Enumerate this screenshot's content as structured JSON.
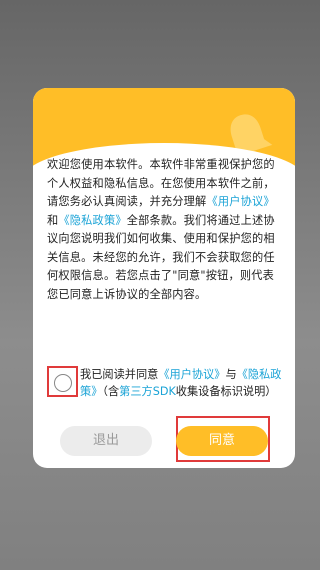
{
  "dialog": {
    "paragraphs": [
      {
        "segments": [
          {
            "text": "欢迎您使用本软件。本软件非常重视保护您的个人权益和隐私信息。在您使用本软件之前，请您务必认真阅读，并充分理解",
            "link": false
          },
          {
            "text": "《用户协议》",
            "link": true
          },
          {
            "text": "和",
            "link": false
          },
          {
            "text": "《隐私政策》",
            "link": true
          },
          {
            "text": "全部条款。我们将通过上述协议向您说明我们如何收集、使用和保护您的相关信息。未经您的允许，我们不会获取您的任何权限信息。若您点击了\"同意\"按钮，则代表您已同意上诉协议的全部内容。",
            "link": false
          }
        ]
      }
    ],
    "agree": {
      "segments": [
        {
          "text": "我已阅读并同意",
          "link": false
        },
        {
          "text": "《用户协议》",
          "link": true
        },
        {
          "text": "与",
          "link": false
        },
        {
          "text": "《隐私政策》",
          "link": true
        },
        {
          "text": "（含",
          "link": false
        },
        {
          "text": "第三方SDK",
          "link": true
        },
        {
          "text": "收集设备标识说明）",
          "link": false
        }
      ]
    },
    "buttons": {
      "exit_label": "退出",
      "agree_label": "同意"
    }
  },
  "colors": {
    "accent": "#ffbe27",
    "link": "#1aa3d6",
    "highlight_border": "#e03a3a"
  },
  "icons": {
    "header_icon": "bell-icon"
  }
}
